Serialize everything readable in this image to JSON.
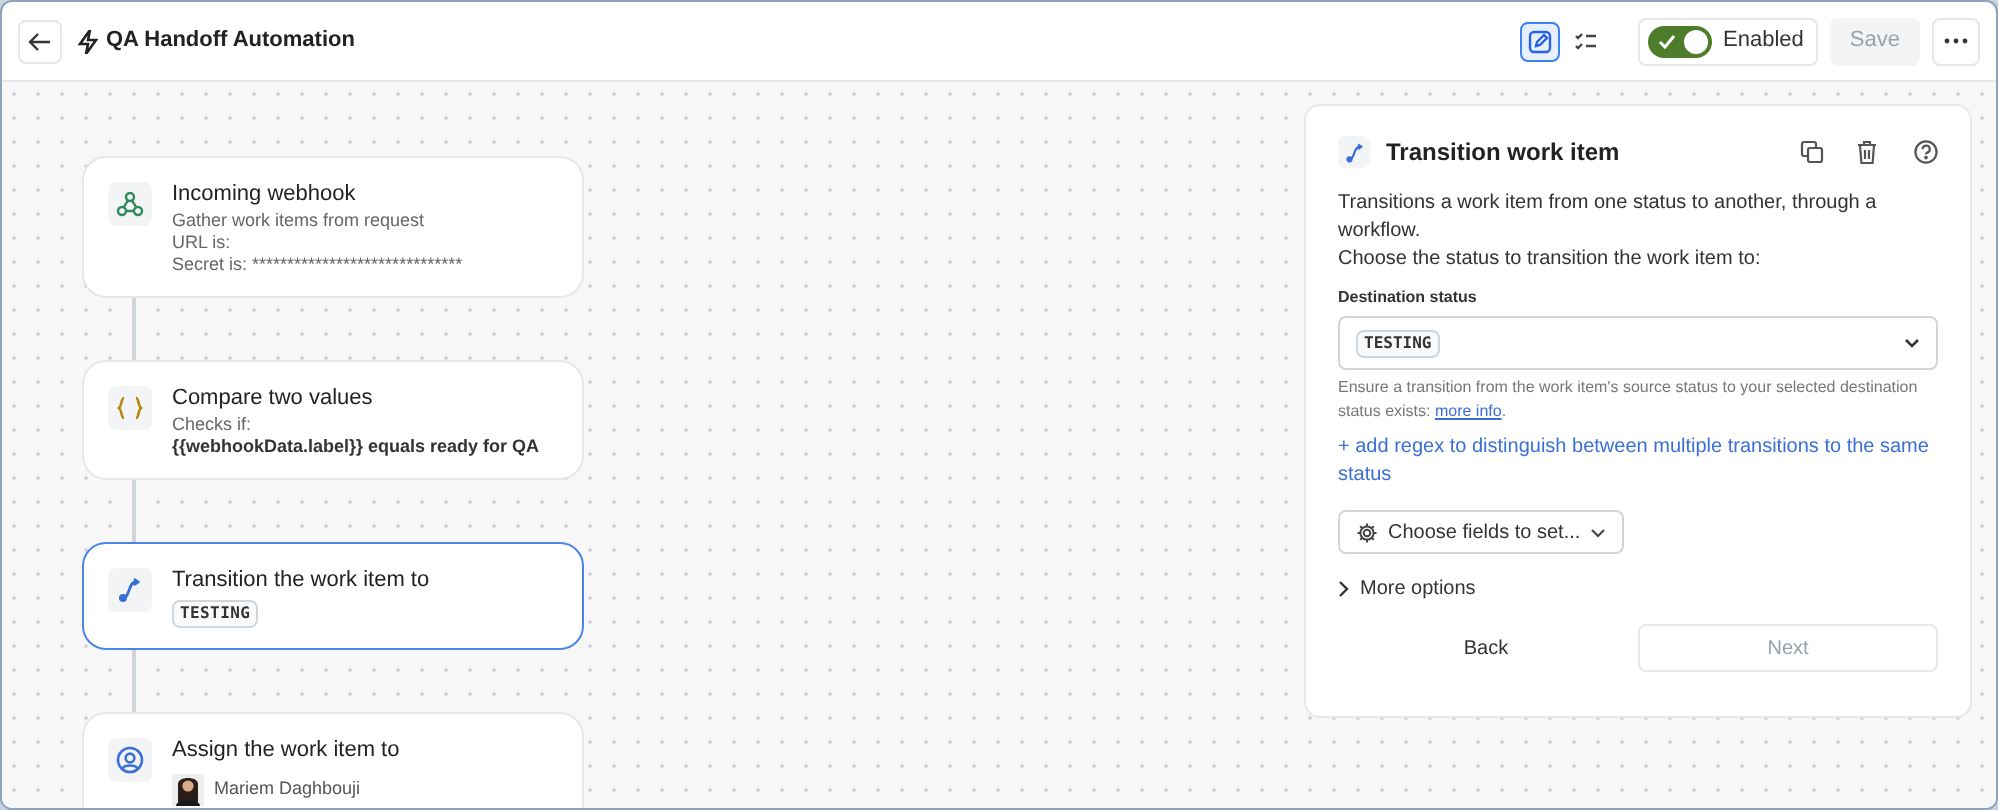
{
  "header": {
    "title": "QA Handoff Automation",
    "view_buttons": [
      {
        "kind": "editor",
        "selected": true
      },
      {
        "kind": "list",
        "selected": false
      }
    ],
    "toggle": {
      "label": "Enabled",
      "on": true
    },
    "save": {
      "label": "Save",
      "disabled": true
    }
  },
  "nodes": [
    {
      "kind": "webhook",
      "title": "Incoming webhook",
      "selected": false,
      "lines": [
        {
          "text": "Gather work items from request",
          "bold": false
        },
        {
          "text": "URL is:",
          "bold": false
        },
        {
          "text": "Secret is: ******************************",
          "bold": false
        }
      ]
    },
    {
      "kind": "condition",
      "title": "Compare two values",
      "selected": false,
      "lines": [
        {
          "text": "Checks if:",
          "bold": false
        },
        {
          "text": "{{webhookData.label}} equals ready for QA",
          "bold": true
        }
      ]
    },
    {
      "kind": "transition",
      "title": "Transition the work item to",
      "selected": true,
      "badge": "TESTING"
    },
    {
      "kind": "assign",
      "title": "Assign the work item to",
      "selected": false,
      "assignee": "Mariem Daghbouji"
    }
  ],
  "panel": {
    "title": "Transition work item",
    "description": [
      "Transitions a work item from one status to another, through a workflow.",
      "Choose the status to transition the work item to:"
    ],
    "field_label": "Destination status",
    "field_value": "TESTING",
    "hint": "Ensure a transition from the work item's source status to your selected destination status exists:",
    "hint_link": "more info",
    "hint_end": ".",
    "regex_link": "+ add regex to distinguish between multiple transitions to the same status",
    "fields_button": "Choose fields to set...",
    "more_options": {
      "label": "More options",
      "expanded": false
    },
    "back": {
      "label": "Back",
      "disabled": false
    },
    "next": {
      "label": "Next",
      "disabled": true
    }
  }
}
